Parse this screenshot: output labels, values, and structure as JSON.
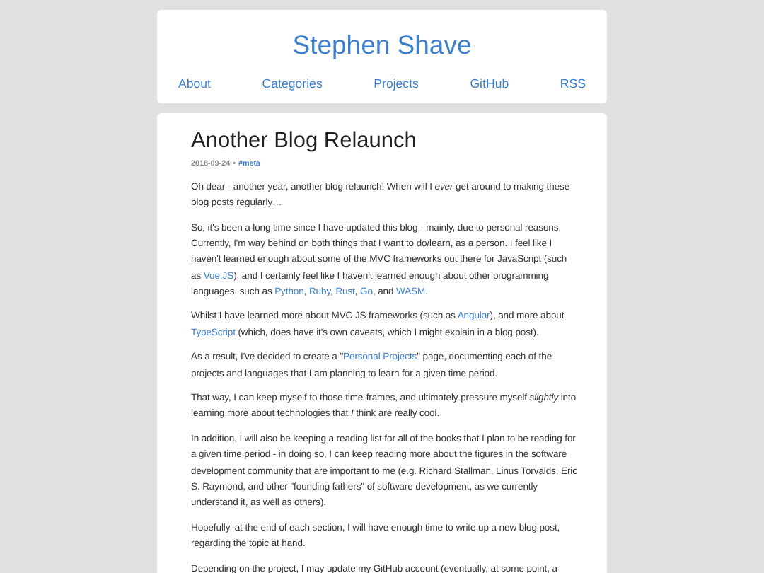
{
  "site_title": "Stephen Shave",
  "nav": [
    "About",
    "Categories",
    "Projects",
    "GitHub",
    "RSS"
  ],
  "post": {
    "title": "Another Blog Relaunch",
    "date": "2018-09-24",
    "separator": "•",
    "tag": "#meta",
    "paragraphs": [
      [
        {
          "kind": "text",
          "text": "Oh dear - another year, another blog relaunch! When will I "
        },
        {
          "kind": "italic",
          "text": "ever"
        },
        {
          "kind": "text",
          "text": " get around to making these blog posts regularly…"
        }
      ],
      [
        {
          "kind": "text",
          "text": "So, it's been a long time since I have updated this blog - mainly, due to personal reasons. Currently, I'm way behind on both things that I want to do/learn, as a person. I feel like I haven't learned enough about some of the MVC frameworks out there for JavaScript (such as "
        },
        {
          "kind": "link",
          "text": "Vue.JS"
        },
        {
          "kind": "text",
          "text": "), and I certainly feel like I haven't learned enough about other programming languages, such as "
        },
        {
          "kind": "link",
          "text": "Python"
        },
        {
          "kind": "text",
          "text": ", "
        },
        {
          "kind": "link",
          "text": "Ruby"
        },
        {
          "kind": "text",
          "text": ", "
        },
        {
          "kind": "link",
          "text": "Rust"
        },
        {
          "kind": "text",
          "text": ", "
        },
        {
          "kind": "link",
          "text": "Go"
        },
        {
          "kind": "text",
          "text": ", and "
        },
        {
          "kind": "link",
          "text": "WASM"
        },
        {
          "kind": "text",
          "text": "."
        }
      ],
      [
        {
          "kind": "text",
          "text": "Whilst I have learned more about MVC JS frameworks (such as "
        },
        {
          "kind": "link",
          "text": "Angular"
        },
        {
          "kind": "text",
          "text": "), and more about "
        },
        {
          "kind": "link",
          "text": "TypeScript"
        },
        {
          "kind": "text",
          "text": " (which, does have it's own caveats, which I might explain in a blog post)."
        }
      ],
      [
        {
          "kind": "text",
          "text": "As a result, I've decided to create a \""
        },
        {
          "kind": "link",
          "text": "Personal Projects"
        },
        {
          "kind": "text",
          "text": "\" page, documenting each of the projects and languages that I am planning to learn for a given time period."
        }
      ],
      [
        {
          "kind": "text",
          "text": "That way, I can keep myself to those time-frames, and ultimately pressure myself "
        },
        {
          "kind": "italic",
          "text": "slightly"
        },
        {
          "kind": "text",
          "text": " into learning more about technologies that "
        },
        {
          "kind": "italic",
          "text": "I"
        },
        {
          "kind": "text",
          "text": " think are really cool."
        }
      ],
      [
        {
          "kind": "text",
          "text": "In addition, I will also be keeping a reading list for all of the books that I plan to be reading for a given time period - in doing so, I can keep reading more about the figures in the software development community that are important to me (e.g. Richard Stallman, Linus Torvalds, Eric S. Raymond, and other \"founding fathers\" of software development, as we currently understand it, as well as others)."
        }
      ],
      [
        {
          "kind": "text",
          "text": "Hopefully, at the end of each section, I will have enough time to write up a new blog post, regarding the topic at hand."
        }
      ],
      [
        {
          "kind": "text",
          "text": "Depending on the project, I may update my GitHub account (eventually, at some point, a"
        }
      ]
    ]
  }
}
